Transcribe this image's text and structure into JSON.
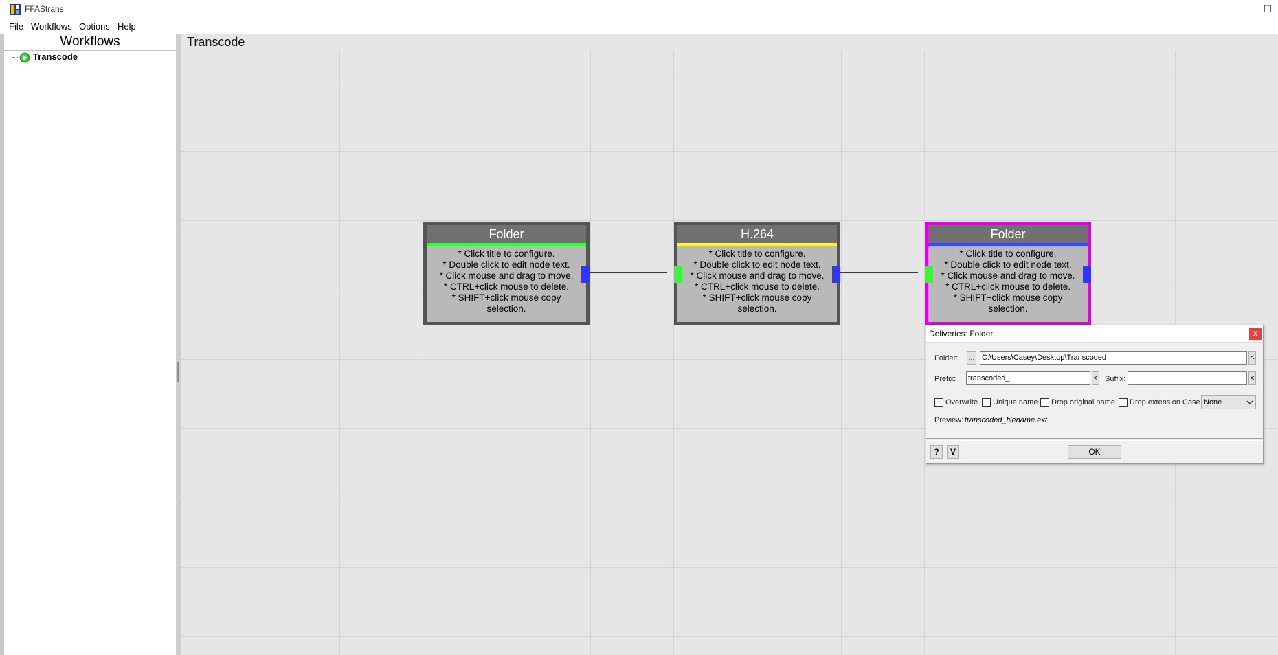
{
  "window": {
    "title": "FFAStrans",
    "minimize_glyph": "—",
    "maximize_glyph": "☐"
  },
  "menu": [
    "File",
    "Workflows",
    "Options",
    "Help"
  ],
  "sidebar": {
    "header": "Workflows",
    "items": [
      {
        "label": "Transcode",
        "icon": "play-icon"
      }
    ]
  },
  "canvas": {
    "title": "Transcode",
    "nodes": [
      {
        "title": "Folder",
        "stripe_color": "#3ef33e",
        "lines": [
          "* Click title to configure.",
          "* Double click to edit node text.",
          "* Click mouse and drag to move.",
          "* CTRL+click mouse to delete.",
          "* SHIFT+click mouse copy",
          "selection."
        ]
      },
      {
        "title": "H.264",
        "stripe_color": "#f7f34a",
        "lines": [
          "* Click title to configure.",
          "* Double click to edit node text.",
          "* Click mouse and drag to move.",
          "* CTRL+click mouse to delete.",
          "* SHIFT+click mouse copy",
          "selection."
        ]
      },
      {
        "title": "Folder",
        "stripe_color": "#3b48f5",
        "lines": [
          "* Click title to configure.",
          "* Double click to edit node text.",
          "* Click mouse and drag to move.",
          "* CTRL+click mouse to delete.",
          "* SHIFT+click mouse copy",
          "selection."
        ]
      }
    ]
  },
  "dialog": {
    "title": "Deliveries: Folder",
    "close_label": "x",
    "folder_label": "Folder:",
    "browse_label": "...",
    "folder_value": "C:\\Users\\Casey\\Desktop\\Transcoded",
    "arrow_label": "<",
    "prefix_label": "Prefix:",
    "prefix_value": "transcoded_",
    "suffix_label": "Suffix:",
    "suffix_value": "",
    "checkboxes": [
      "Overwrite",
      "Unique name",
      "Drop original name",
      "Drop extension"
    ],
    "case_label": "Case",
    "case_value": "None",
    "preview_label": "Preview:",
    "preview_value": "transcoded_filename.ext",
    "help_label": "?",
    "v_label": "V",
    "ok_label": "OK"
  },
  "colors": {
    "selected_border": "#e000e0",
    "port_in": "#3ef33e",
    "port_out": "#3333ff",
    "close_button": "#e04343"
  }
}
